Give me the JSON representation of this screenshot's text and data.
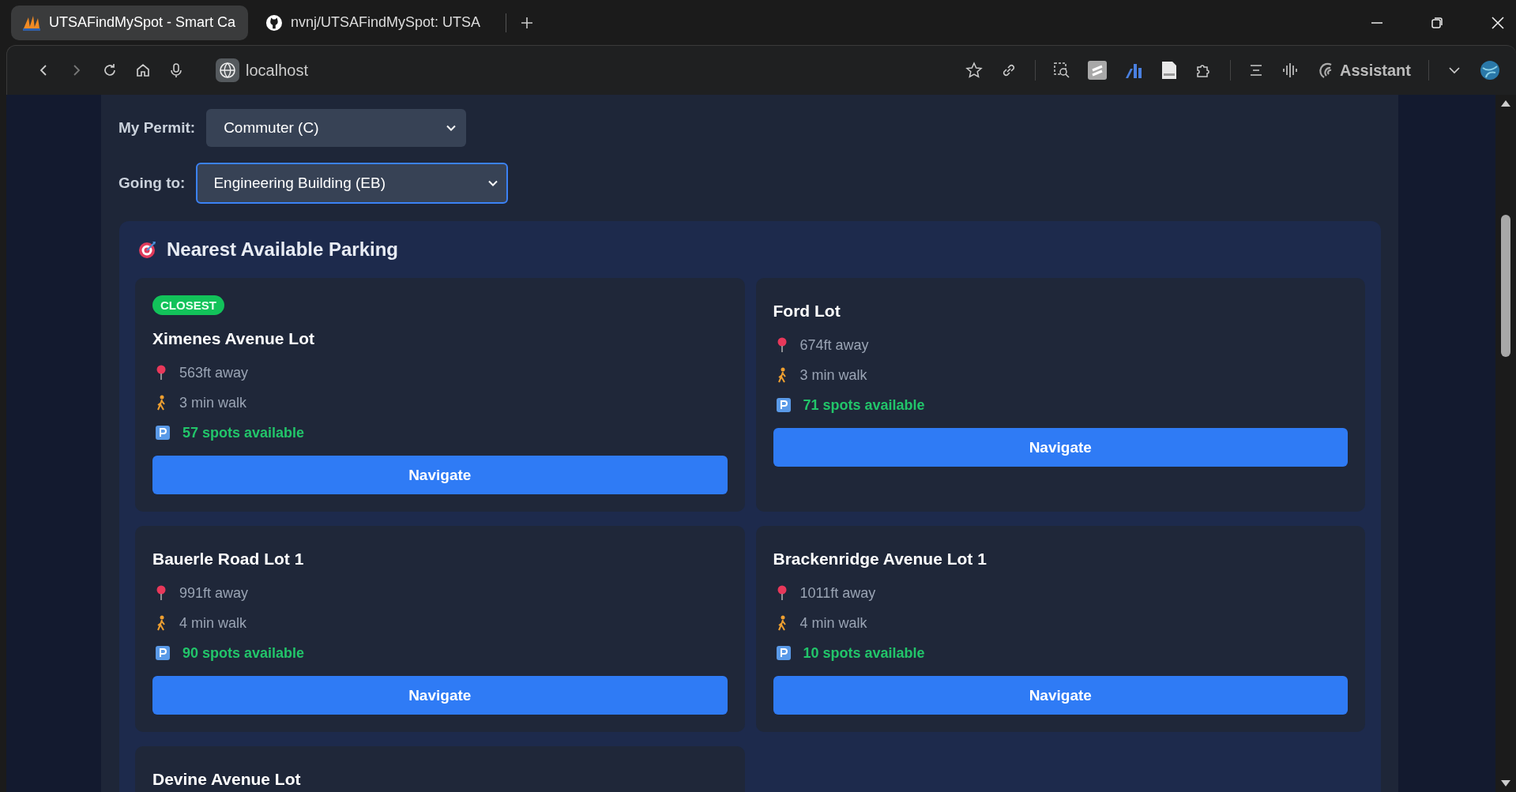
{
  "browser": {
    "tabs": [
      {
        "title": "UTSAFindMySpot - Smart Ca",
        "kind": "app",
        "selected": true
      },
      {
        "title": "nvnj/UTSAFindMySpot: UTSA",
        "kind": "github",
        "selected": false
      }
    ],
    "address": "localhost",
    "assistant": "Assistant"
  },
  "filters": [
    {
      "label": "My Permit:",
      "value": "Commuter (C)",
      "focused": false
    },
    {
      "label": "Going to:",
      "value": "Engineering Building (EB)",
      "focused": true
    }
  ],
  "section": {
    "title": "Nearest Available Parking"
  },
  "lots": [
    {
      "badge": "CLOSEST",
      "name": "Ximenes Avenue Lot",
      "distance": "563ft away",
      "walk": "3 min walk",
      "spots": "57 spots available",
      "button": "Navigate"
    },
    {
      "name": "Ford Lot",
      "distance": "674ft away",
      "walk": "3 min walk",
      "spots": "71 spots available",
      "button": "Navigate"
    },
    {
      "name": "Bauerle Road Lot 1",
      "distance": "991ft away",
      "walk": "4 min walk",
      "spots": "90 spots available",
      "button": "Navigate"
    },
    {
      "name": "Brackenridge Avenue Lot 1",
      "distance": "1011ft away",
      "walk": "4 min walk",
      "spots": "10 spots available",
      "button": "Navigate"
    },
    {
      "name": "Devine Avenue Lot"
    }
  ]
}
